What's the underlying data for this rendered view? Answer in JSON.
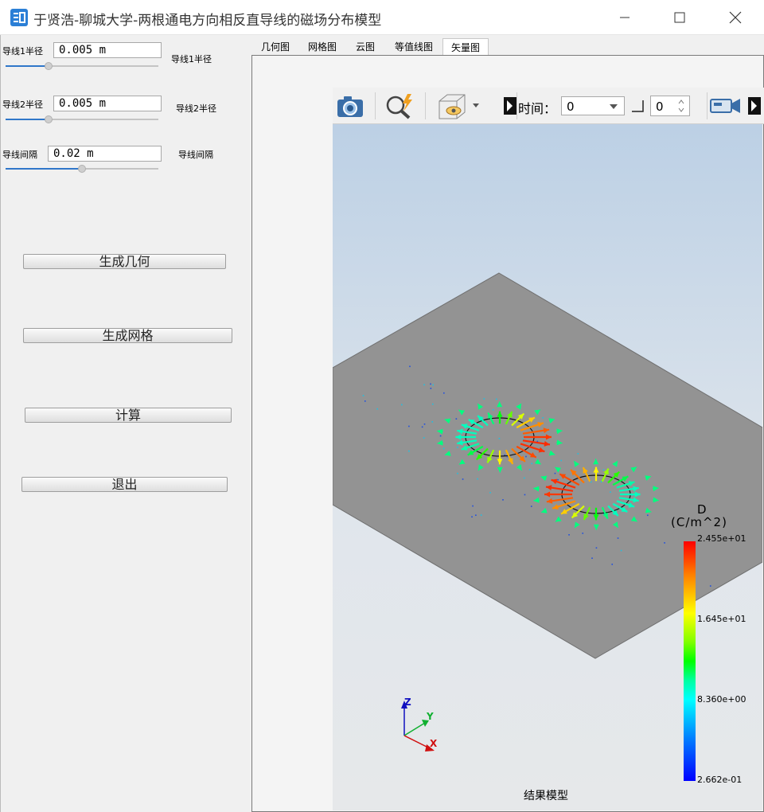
{
  "window": {
    "title": "于贤浩-聊城大学-两根通电方向相反直导线的磁场分布模型"
  },
  "params": {
    "r1": {
      "label": "导线1半径",
      "value": "0.005 m",
      "side_label": "导线1半径",
      "fraction": 0.28
    },
    "r2": {
      "label": "导线2半径",
      "value": "0.005 m",
      "side_label": "导线2半径",
      "fraction": 0.28
    },
    "gap": {
      "label": "导线间隔",
      "value": "0.02 m",
      "side_label": "导线间隔",
      "fraction": 0.5
    }
  },
  "buttons": {
    "gen_geometry": "生成几何",
    "gen_mesh": "生成网格",
    "compute": "计算",
    "exit": "退出"
  },
  "tabs": [
    {
      "label": "几何图"
    },
    {
      "label": "网格图"
    },
    {
      "label": "云图"
    },
    {
      "label": "等值线图"
    },
    {
      "label": "矢量图",
      "active": true
    }
  ],
  "toolbar": {
    "icons": [
      "camera-icon",
      "zoom-lightning-icon",
      "visibility-box-icon",
      "camera-video-icon"
    ],
    "time_label": "时间：",
    "time_value": "0",
    "step_value": "0"
  },
  "legend": {
    "title": "D",
    "unit": "(C/m^2)",
    "ticks": [
      "2.455e+01",
      "1.645e+01",
      "8.360e+00",
      "2.662e-01"
    ]
  },
  "axes": {
    "z": "Z",
    "y": "Y",
    "x": "X"
  },
  "caption": "结果模型",
  "colors": {
    "accent": "#3077c9",
    "plate": "#939393",
    "arrow_max": "#ff0000",
    "arrow_min": "#0000ff"
  }
}
